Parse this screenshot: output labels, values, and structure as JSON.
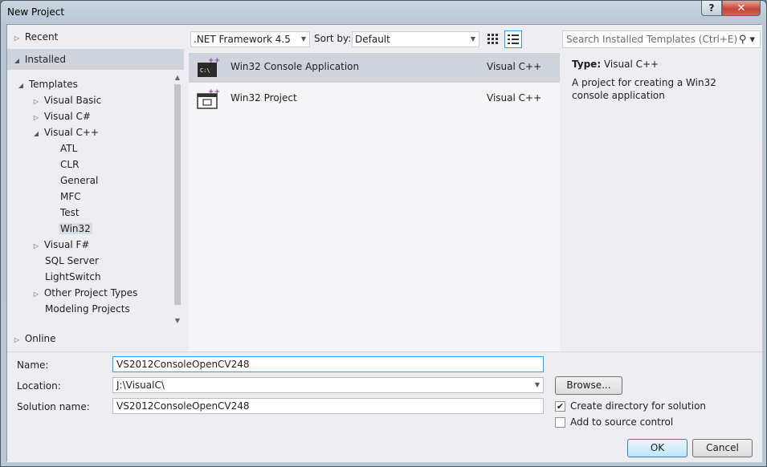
{
  "window": {
    "title": "New Project",
    "help_label": "?",
    "close_label": "✕"
  },
  "tree": {
    "recent": "Recent",
    "installed": "Installed",
    "templates": "Templates",
    "items": [
      {
        "label": "Visual Basic"
      },
      {
        "label": "Visual C#"
      },
      {
        "label": "Visual C++"
      },
      {
        "label": "ATL"
      },
      {
        "label": "CLR"
      },
      {
        "label": "General"
      },
      {
        "label": "MFC"
      },
      {
        "label": "Test"
      },
      {
        "label": "Win32"
      },
      {
        "label": "Visual F#"
      },
      {
        "label": "SQL Server"
      },
      {
        "label": "LightSwitch"
      },
      {
        "label": "Other Project Types"
      },
      {
        "label": "Modeling Projects"
      }
    ],
    "online": "Online"
  },
  "toolbar": {
    "framework": ".NET Framework 4.5",
    "sort_label": "Sort by:",
    "sort_value": "Default",
    "search_placeholder": "Search Installed Templates (Ctrl+E)"
  },
  "templates": [
    {
      "name": "Win32 Console Application",
      "lang": "Visual C++"
    },
    {
      "name": "Win32 Project",
      "lang": "Visual C++"
    }
  ],
  "description": {
    "type_label": "Type:",
    "type_value": "Visual C++",
    "text": "A project for creating a Win32 console application"
  },
  "form": {
    "name_label": "Name:",
    "name_value": "VS2012ConsoleOpenCV248",
    "location_label": "Location:",
    "location_value": "J:\\VisualC\\",
    "solution_label": "Solution name:",
    "solution_value": "VS2012ConsoleOpenCV248",
    "browse_label": "Browse...",
    "create_dir_label": "Create directory for solution",
    "create_dir_checked": true,
    "source_control_label": "Add to source control",
    "source_control_checked": false,
    "ok_label": "OK",
    "cancel_label": "Cancel"
  }
}
